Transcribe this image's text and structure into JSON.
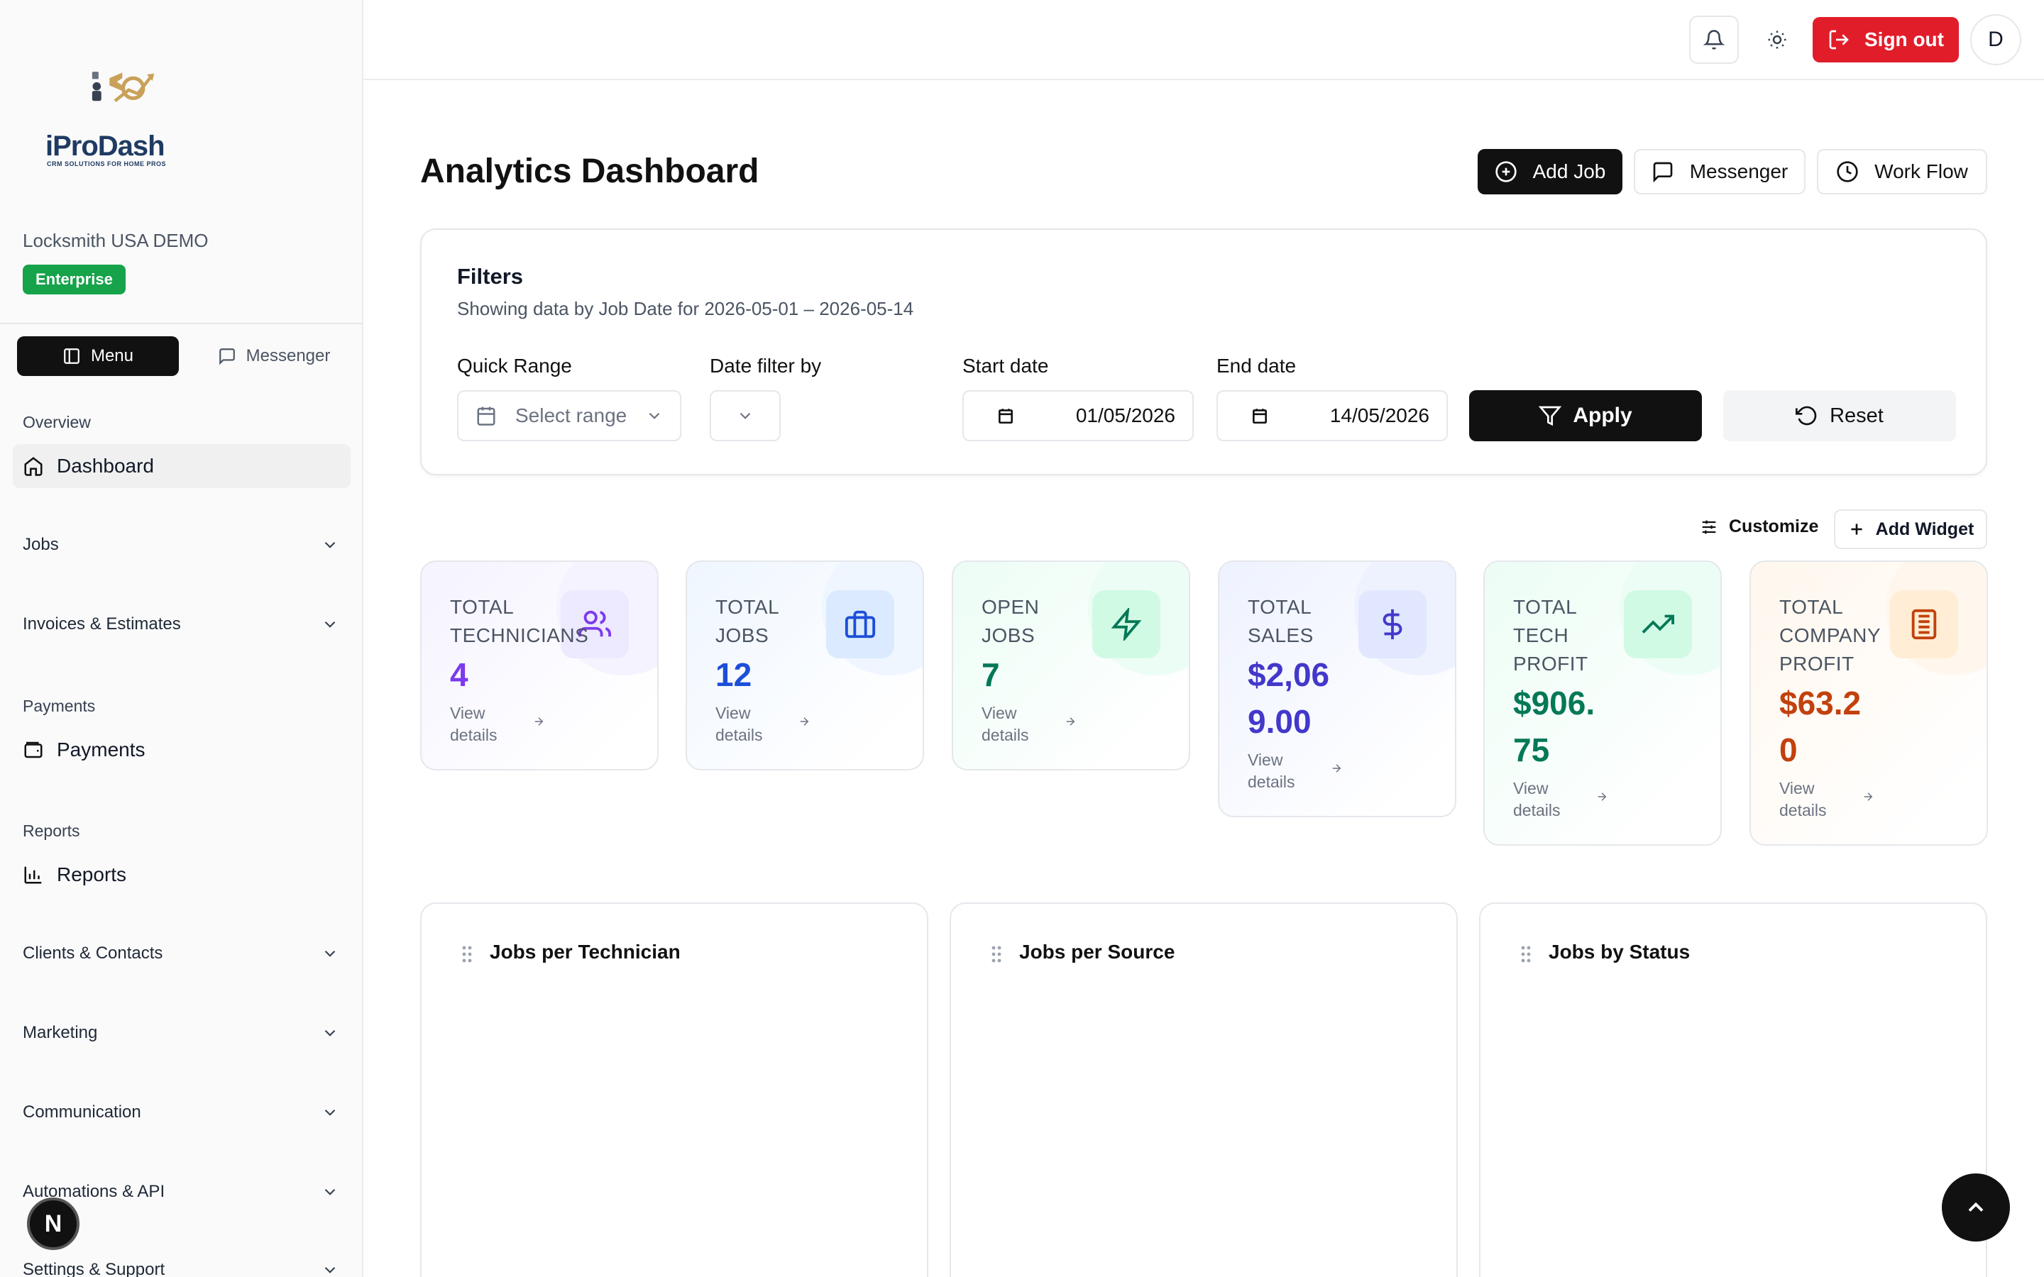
{
  "brand": {
    "name": "iProDash",
    "tagline": "CRM SOLUTIONS FOR HOME PROS"
  },
  "account": {
    "company": "Locksmith USA DEMO",
    "plan": "Enterprise"
  },
  "sidebar": {
    "tabs": {
      "menu": "Menu",
      "messenger": "Messenger"
    },
    "sections": [
      {
        "label": "Overview",
        "items": [
          "Dashboard"
        ]
      },
      {
        "label": "Jobs"
      },
      {
        "label": "Invoices & Estimates"
      },
      {
        "label": "Payments",
        "items": [
          "Payments"
        ]
      },
      {
        "label": "Reports",
        "items": [
          "Reports"
        ]
      },
      {
        "label": "Clients & Contacts"
      },
      {
        "label": "Marketing"
      },
      {
        "label": "Communication"
      },
      {
        "label": "Automations & API"
      },
      {
        "label": "Settings & Support"
      }
    ],
    "fab_letter": "N"
  },
  "topbar": {
    "signout": "Sign out",
    "avatar_letter": "D"
  },
  "page": {
    "title": "Analytics Dashboard",
    "actions": {
      "add_job": "Add Job",
      "messenger": "Messenger",
      "workflow": "Work Flow"
    }
  },
  "filters": {
    "title": "Filters",
    "subtitle": "Showing data by Job Date for 2026-05-01 – 2026-05-14",
    "quick_range": {
      "label": "Quick Range",
      "placeholder": "Select range"
    },
    "date_filter": {
      "label": "Date filter by",
      "value": ""
    },
    "start_date": {
      "label": "Start date",
      "value": "01/05/2026"
    },
    "end_date": {
      "label": "End date",
      "value": "14/05/2026"
    },
    "apply": "Apply",
    "reset": "Reset"
  },
  "widgets_toolbar": {
    "customize": "Customize",
    "add_widget": "Add Widget"
  },
  "stats": [
    {
      "label_lines": [
        "TOTAL",
        "TECHNICIANS"
      ],
      "value_lines": [
        "4"
      ],
      "link_lines": [
        "View",
        "details"
      ],
      "icon": "users-icon",
      "color": "#7c3aed"
    },
    {
      "label_lines": [
        "TOTAL",
        "JOBS"
      ],
      "value_lines": [
        "12"
      ],
      "link_lines": [
        "View",
        "details"
      ],
      "icon": "briefcase-icon",
      "color": "#1d4ed8"
    },
    {
      "label_lines": [
        "OPEN",
        "JOBS"
      ],
      "value_lines": [
        "7"
      ],
      "link_lines": [
        "View",
        "details"
      ],
      "icon": "zap-icon",
      "color": "#047857"
    },
    {
      "label_lines": [
        "TOTAL",
        "SALES"
      ],
      "value_lines": [
        "$2,06",
        "9.00"
      ],
      "link_lines": [
        "View",
        "details"
      ],
      "icon": "dollar-icon",
      "color": "#4338ca"
    },
    {
      "label_lines": [
        "TOTAL",
        "TECH",
        "PROFIT"
      ],
      "value_lines": [
        "$906.",
        "75"
      ],
      "link_lines": [
        "View",
        "details"
      ],
      "icon": "trending-up-icon",
      "color": "#047857"
    },
    {
      "label_lines": [
        "TOTAL",
        "COMPANY",
        "PROFIT"
      ],
      "value_lines": [
        "$63.2",
        "0"
      ],
      "link_lines": [
        "View",
        "details"
      ],
      "icon": "building-icon",
      "color": "#c2410c"
    }
  ],
  "chart_widgets": [
    {
      "title": "Jobs per Technician"
    },
    {
      "title": "Jobs per Source"
    },
    {
      "title": "Jobs by Status"
    }
  ]
}
